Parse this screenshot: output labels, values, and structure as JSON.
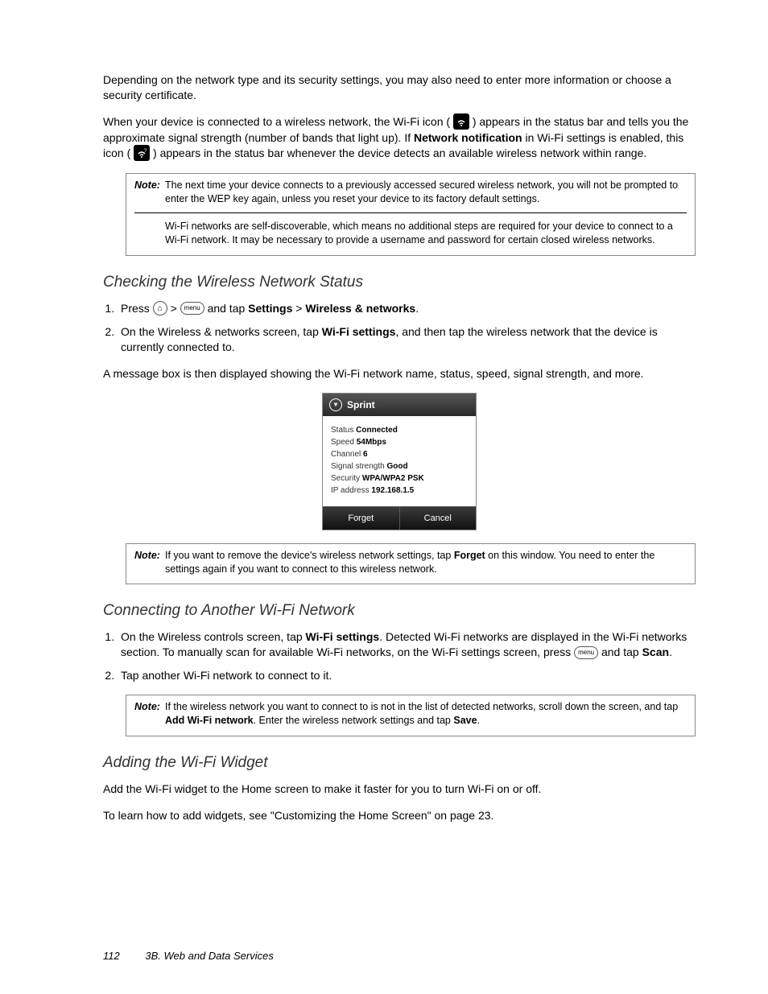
{
  "para1": "Depending on the network type and its security settings, you may also need to enter more information or choose a security certificate.",
  "para2a": "When your device is connected to a wireless network, the Wi-Fi icon (",
  "para2b": ") appears in the status bar and tells you the approximate signal strength (number of bands that light up). If ",
  "para2_bold1": "Network notification",
  "para2c": " in Wi-Fi settings is enabled, this icon (",
  "para2d": ") appears in the status bar whenever the device detects an available wireless network within range.",
  "note1": {
    "label": "Note:",
    "body1": "The next time your device connects to a previously accessed secured wireless network, you will not be prompted to enter the WEP key again, unless you reset your device to its factory default settings.",
    "body2": "Wi-Fi networks are self-discoverable, which means no additional steps are required for your device to connect to a Wi-Fi network. It may be necessary to provide a username and password for certain closed wireless networks."
  },
  "h1": "Checking the Wireless Network Status",
  "s1_li1a": "Press ",
  "s1_li1b": " and tap ",
  "s1_li1_b1": "Settings",
  "s1_li1_gt": " > ",
  "s1_li1_b2": "Wireless & networks",
  "s1_li1c": ".",
  "s1_li2a": "On the Wireless & networks screen, tap ",
  "s1_li2_b1": "Wi-Fi settings",
  "s1_li2b": ", and then tap the wireless network that the device is currently connected to.",
  "s1_after": "A message box is then displayed showing the Wi-Fi network name, status, speed, signal strength, and more.",
  "dialog": {
    "title": "Sprint",
    "rows": [
      {
        "label": "Status",
        "value": "Connected"
      },
      {
        "label": "Speed",
        "value": "54Mbps"
      },
      {
        "label": "Channel",
        "value": "6"
      },
      {
        "label": "Signal strength",
        "value": "Good"
      },
      {
        "label": "Security",
        "value": "WPA/WPA2 PSK"
      },
      {
        "label": "IP address",
        "value": "192.168.1.5"
      }
    ],
    "btn_forget": "Forget",
    "btn_cancel": "Cancel"
  },
  "note2": {
    "label": "Note:",
    "a": "If you want to remove the device's wireless network settings, tap ",
    "b1": "Forget",
    "b": " on this window. You need to enter the settings again if you want to connect to this wireless network."
  },
  "h2": "Connecting to Another Wi-Fi Network",
  "s2_li1a": "On the Wireless controls screen, tap ",
  "s2_li1_b1": "Wi-Fi settings",
  "s2_li1b": ". Detected Wi-Fi networks are displayed in the Wi-Fi networks section. To manually scan for available Wi-Fi networks, on the Wi-Fi settings screen, press ",
  "s2_li1c": " and tap ",
  "s2_li1_b2": "Scan",
  "s2_li1d": ".",
  "s2_li2": "Tap another Wi-Fi network to connect to it.",
  "note3": {
    "label": "Note:",
    "a": "If the wireless network you want to connect to is not in the list of detected networks, scroll down the screen, and tap ",
    "b1": "Add Wi-Fi network",
    "b": ". Enter the wireless network settings and tap ",
    "b2": "Save",
    "c": "."
  },
  "h3": "Adding the Wi-Fi Widget",
  "s3_p1": "Add the Wi-Fi widget to the Home screen to make it faster for you to turn Wi-Fi on or off.",
  "s3_p2": "To learn how to add widgets, see \"Customizing the Home Screen\" on page 23.",
  "footer_page": "112",
  "footer_section": "3B. Web and Data Services",
  "gt": ">",
  "menu_label": "menu"
}
